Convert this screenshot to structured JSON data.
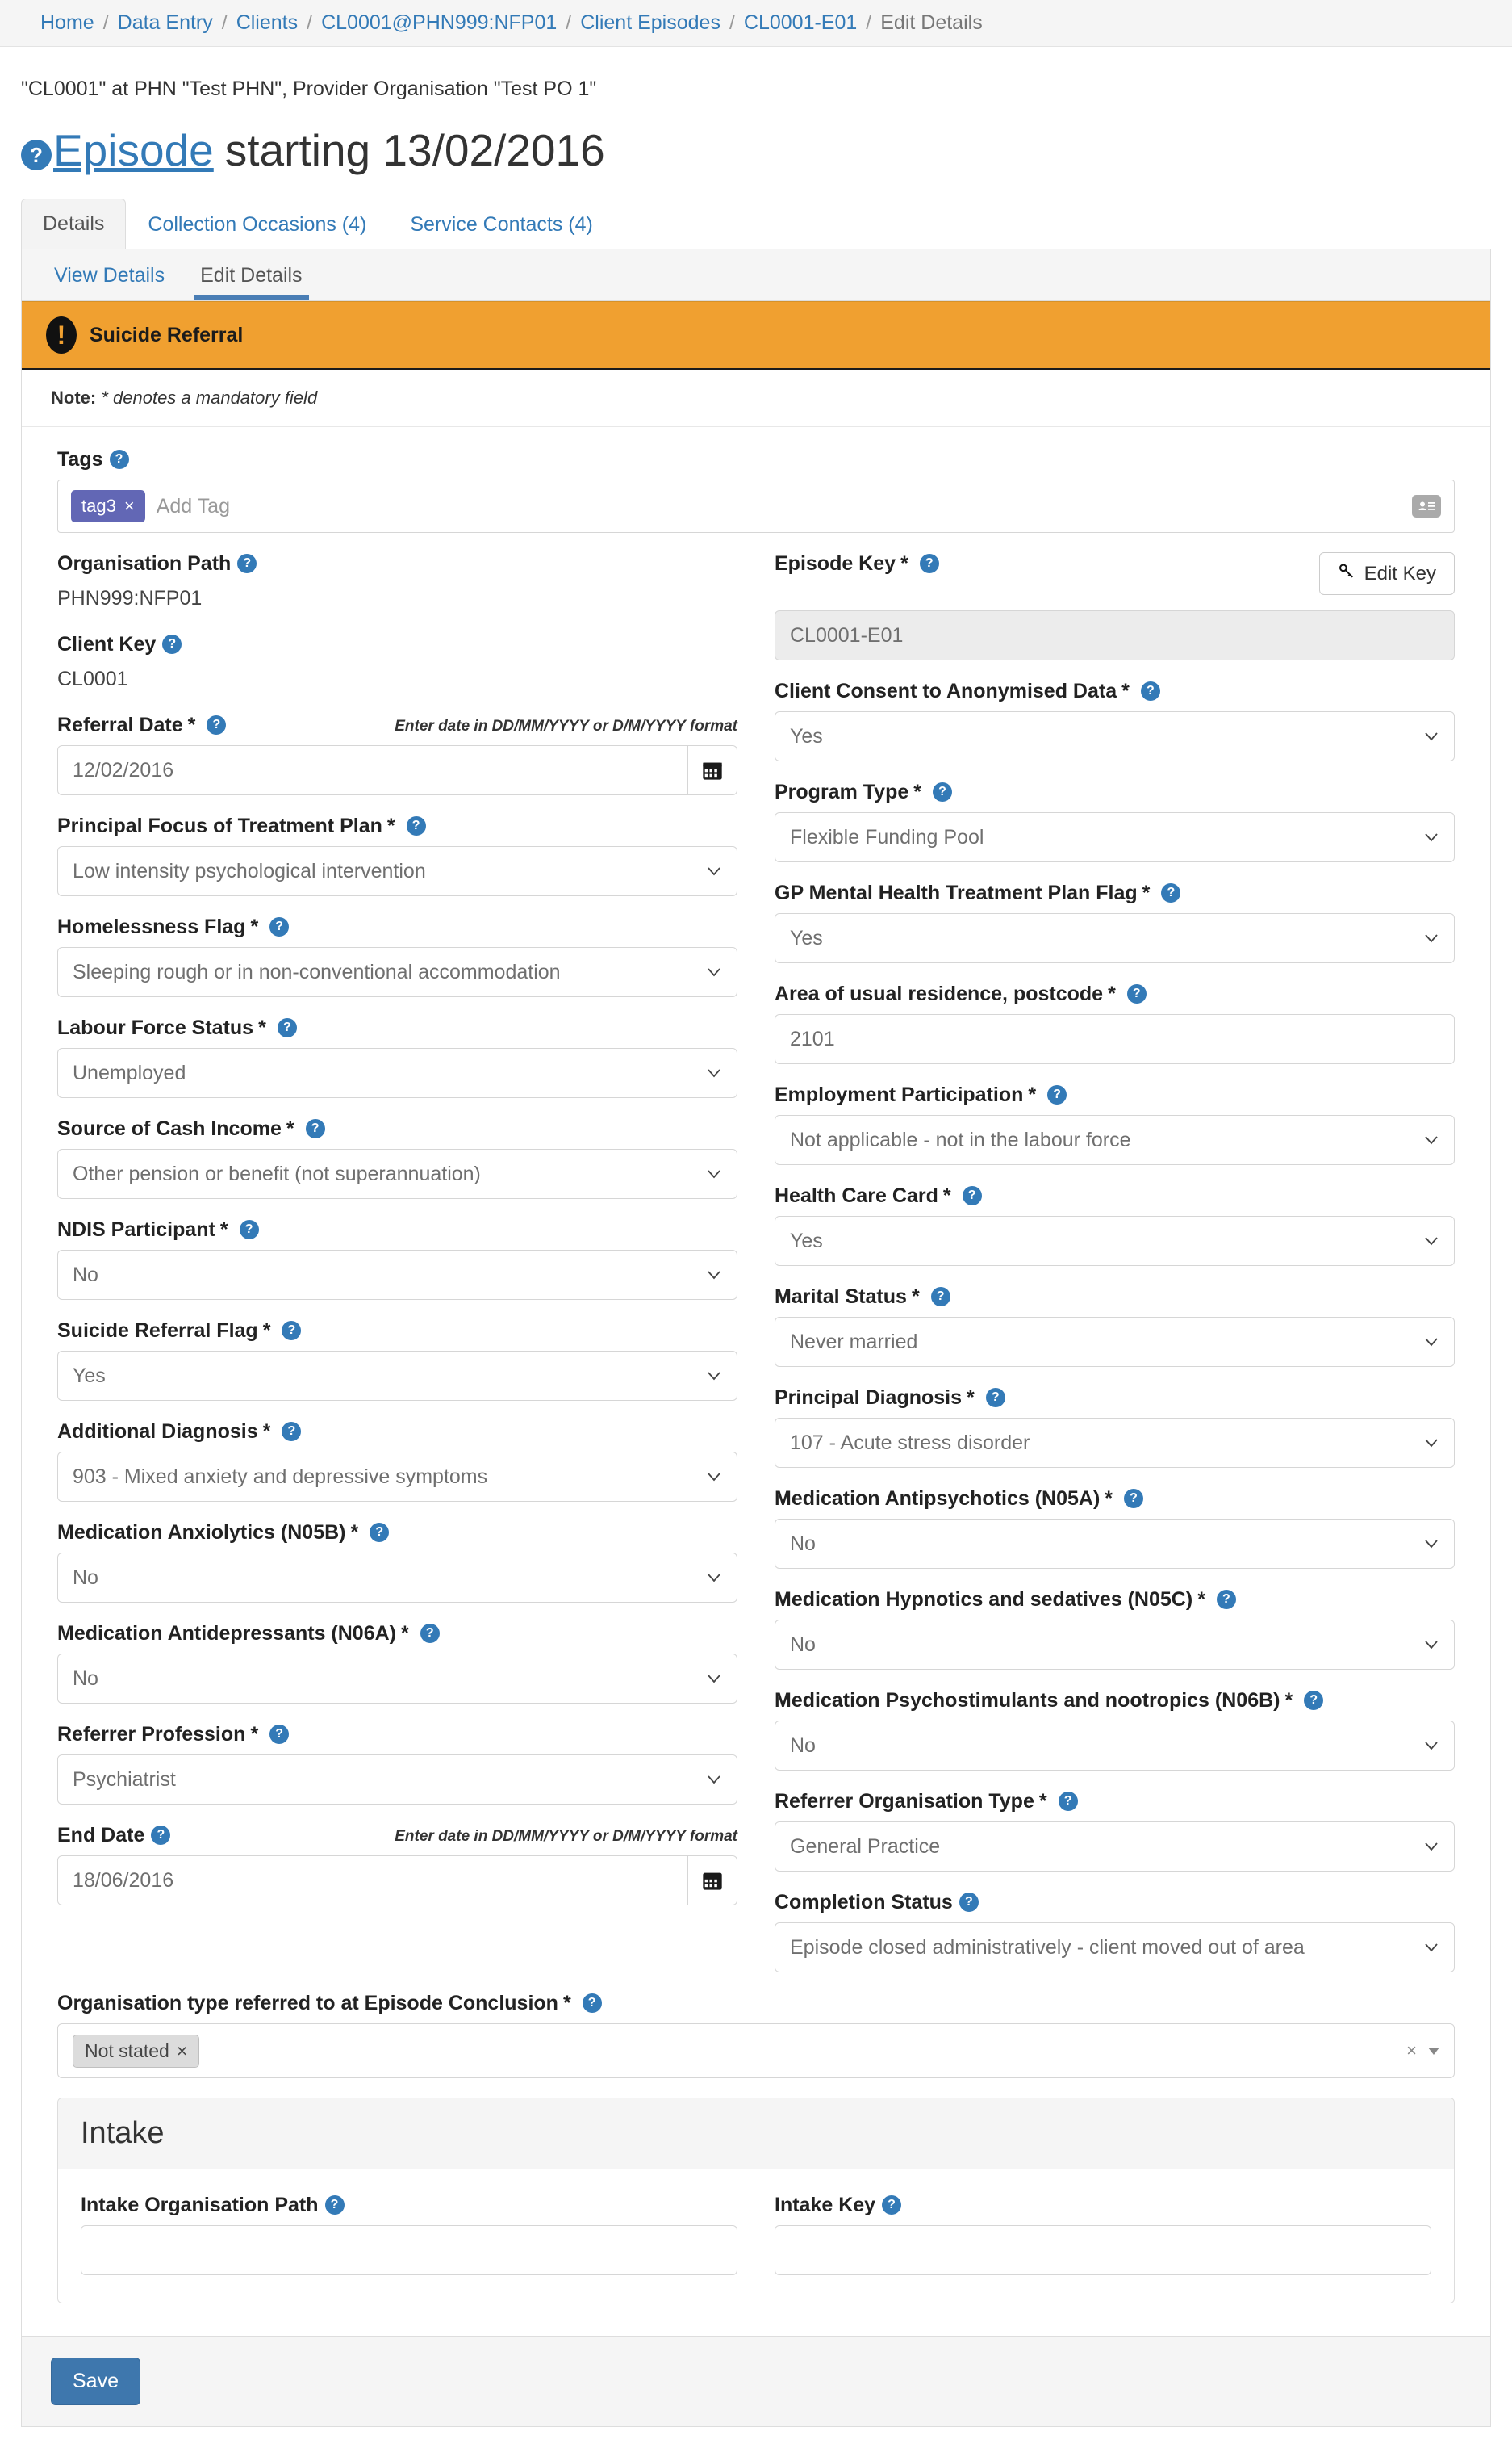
{
  "breadcrumb": {
    "items": [
      {
        "label": "Home",
        "link": true
      },
      {
        "label": "Data Entry",
        "link": true
      },
      {
        "label": "Clients",
        "link": true
      },
      {
        "label": "CL0001@PHN999:NFP01",
        "link": true
      },
      {
        "label": "Client Episodes",
        "link": true
      },
      {
        "label": "CL0001-E01",
        "link": true
      },
      {
        "label": "Edit Details",
        "link": false
      }
    ],
    "separator": "/"
  },
  "header": {
    "context_line": "\"CL0001\" at PHN \"Test PHN\", Provider Organisation \"Test PO 1\"",
    "title_link": "Episode",
    "title_rest": "starting 13/02/2016",
    "help_icon": "?"
  },
  "tabs": [
    {
      "label": "Details",
      "active": true
    },
    {
      "label": "Collection Occasions (4)",
      "active": false
    },
    {
      "label": "Service Contacts (4)",
      "active": false
    }
  ],
  "subtabs": [
    {
      "label": "View Details",
      "active": false
    },
    {
      "label": "Edit Details",
      "active": true
    }
  ],
  "alert": {
    "icon": "exclamation-icon",
    "text": "Suicide Referral",
    "bg_color": "#f0a030"
  },
  "note": {
    "bold": "Note:",
    "italic": "* denotes a mandatory field"
  },
  "tags": {
    "label": "Tags",
    "chips": [
      {
        "label": "tag3",
        "remove": "×"
      }
    ],
    "placeholder": "Add Tag",
    "right_icon": "contact-card-icon"
  },
  "fields": {
    "organisation_path": {
      "label": "Organisation Path",
      "value": "PHN999:NFP01"
    },
    "client_key": {
      "label": "Client Key",
      "value": "CL0001"
    },
    "referral_date": {
      "label": "Referral Date",
      "required": true,
      "hint": "Enter date in DD/MM/YYYY or D/M/YYYY format",
      "value": "12/02/2016"
    },
    "principal_focus": {
      "label": "Principal Focus of Treatment Plan",
      "required": true,
      "value": "Low intensity psychological intervention"
    },
    "homelessness_flag": {
      "label": "Homelessness Flag",
      "required": true,
      "value": "Sleeping rough or in non-conventional accommodation"
    },
    "labour_force_status": {
      "label": "Labour Force Status",
      "required": true,
      "value": "Unemployed"
    },
    "source_of_cash_income": {
      "label": "Source of Cash Income",
      "required": true,
      "value": "Other pension or benefit (not superannuation)"
    },
    "ndis_participant": {
      "label": "NDIS Participant",
      "required": true,
      "value": "No"
    },
    "suicide_referral_flag": {
      "label": "Suicide Referral Flag",
      "required": true,
      "value": "Yes"
    },
    "additional_diagnosis": {
      "label": "Additional Diagnosis",
      "required": true,
      "value": "903 - Mixed anxiety and depressive symptoms"
    },
    "medication_anxiolytics": {
      "label": "Medication Anxiolytics (N05B)",
      "required": true,
      "value": "No"
    },
    "medication_antidepressants": {
      "label": "Medication Antidepressants (N06A)",
      "required": true,
      "value": "No"
    },
    "referrer_profession": {
      "label": "Referrer Profession",
      "required": true,
      "value": "Psychiatrist"
    },
    "end_date": {
      "label": "End Date",
      "required": false,
      "hint": "Enter date in DD/MM/YYYY or D/M/YYYY format",
      "value": "18/06/2016"
    },
    "org_type_conclusion": {
      "label": "Organisation type referred to at Episode Conclusion",
      "required": true,
      "chips": [
        {
          "label": "Not stated",
          "remove": "×"
        }
      ],
      "clear": "×"
    },
    "episode_key": {
      "label": "Episode Key",
      "required": true,
      "value": "CL0001-E01",
      "edit_button": "Edit Key",
      "edit_icon": "key-icon"
    },
    "client_consent": {
      "label": "Client Consent to Anonymised Data",
      "required": true,
      "value": "Yes"
    },
    "program_type": {
      "label": "Program Type",
      "required": true,
      "value": "Flexible Funding Pool"
    },
    "gp_mhtp_flag": {
      "label": "GP Mental Health Treatment Plan Flag",
      "required": true,
      "value": "Yes"
    },
    "postcode": {
      "label": "Area of usual residence, postcode",
      "required": true,
      "value": "2101"
    },
    "employment_participation": {
      "label": "Employment Participation",
      "required": true,
      "value": "Not applicable - not in the labour force"
    },
    "health_care_card": {
      "label": "Health Care Card",
      "required": true,
      "value": "Yes"
    },
    "marital_status": {
      "label": "Marital Status",
      "required": true,
      "value": "Never married"
    },
    "principal_diagnosis": {
      "label": "Principal Diagnosis",
      "required": true,
      "value": "107 - Acute stress disorder"
    },
    "medication_antipsychotics": {
      "label": "Medication Antipsychotics (N05A)",
      "required": true,
      "value": "No"
    },
    "medication_hypnotics": {
      "label": "Medication Hypnotics and sedatives (N05C)",
      "required": true,
      "value": "No"
    },
    "medication_psychostimulants": {
      "label": "Medication Psychostimulants and nootropics (N06B)",
      "required": true,
      "value": "No"
    },
    "referrer_org_type": {
      "label": "Referrer Organisation Type",
      "required": true,
      "value": "General Practice"
    },
    "completion_status": {
      "label": "Completion Status",
      "required": false,
      "value": "Episode closed administratively - client moved out of area"
    }
  },
  "intake": {
    "title": "Intake",
    "organisation_path": {
      "label": "Intake Organisation Path",
      "value": ""
    },
    "key": {
      "label": "Intake Key",
      "value": ""
    }
  },
  "footer": {
    "save_label": "Save"
  },
  "colors": {
    "link": "#337ab7",
    "alert_bg": "#f0a030",
    "tag_chip": "#6267b5",
    "primary_button": "#3e77ad"
  }
}
